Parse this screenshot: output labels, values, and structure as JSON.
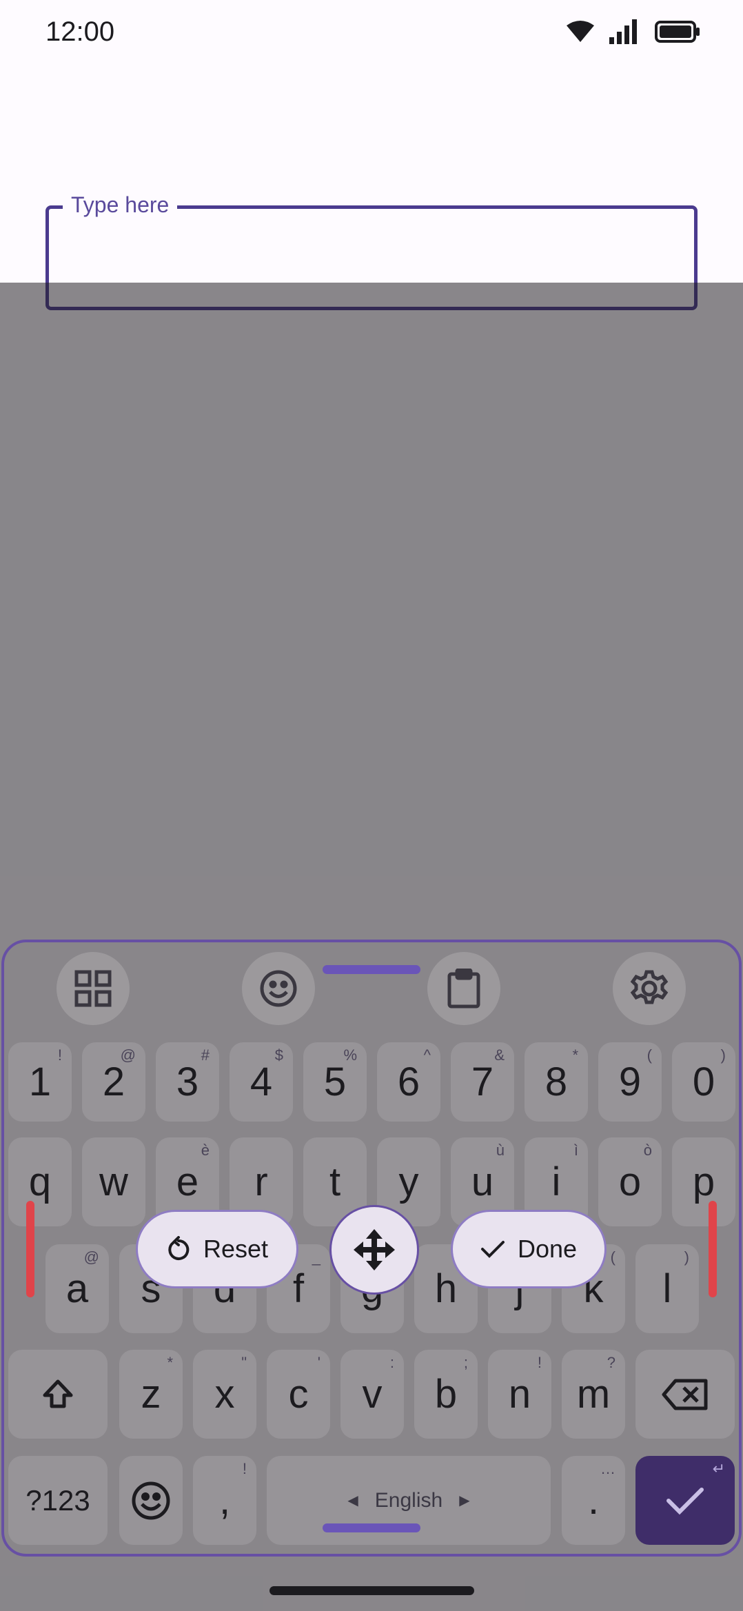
{
  "status_bar": {
    "time": "12:00"
  },
  "text_field": {
    "label": "Type here",
    "value": ""
  },
  "toolbar": {
    "icons": [
      "apps-grid-icon",
      "emoji-icon",
      "clipboard-icon",
      "gear-icon"
    ]
  },
  "keyboard": {
    "number_row": [
      {
        "key": "1",
        "hint": "!"
      },
      {
        "key": "2",
        "hint": "@"
      },
      {
        "key": "3",
        "hint": "#"
      },
      {
        "key": "4",
        "hint": "$"
      },
      {
        "key": "5",
        "hint": "%"
      },
      {
        "key": "6",
        "hint": "^"
      },
      {
        "key": "7",
        "hint": "&"
      },
      {
        "key": "8",
        "hint": "*"
      },
      {
        "key": "9",
        "hint": "("
      },
      {
        "key": "0",
        "hint": ")"
      }
    ],
    "row1": [
      {
        "key": "q",
        "hint": ""
      },
      {
        "key": "w",
        "hint": ""
      },
      {
        "key": "e",
        "hint": "è"
      },
      {
        "key": "r",
        "hint": ""
      },
      {
        "key": "t",
        "hint": ""
      },
      {
        "key": "y",
        "hint": ""
      },
      {
        "key": "u",
        "hint": "ù"
      },
      {
        "key": "i",
        "hint": "ì"
      },
      {
        "key": "o",
        "hint": "ò"
      },
      {
        "key": "p",
        "hint": ""
      }
    ],
    "row2": [
      {
        "key": "a",
        "hint": "@"
      },
      {
        "key": "s",
        "hint": ""
      },
      {
        "key": "d",
        "hint": ""
      },
      {
        "key": "f",
        "hint": "_"
      },
      {
        "key": "g",
        "hint": ""
      },
      {
        "key": "h",
        "hint": ""
      },
      {
        "key": "j",
        "hint": ""
      },
      {
        "key": "k",
        "hint": "("
      },
      {
        "key": "l",
        "hint": ")"
      }
    ],
    "row3": [
      {
        "key": "z",
        "hint": "*"
      },
      {
        "key": "x",
        "hint": "\""
      },
      {
        "key": "c",
        "hint": "'"
      },
      {
        "key": "v",
        "hint": ":"
      },
      {
        "key": "b",
        "hint": ";"
      },
      {
        "key": "n",
        "hint": "!"
      },
      {
        "key": "m",
        "hint": "?"
      }
    ],
    "symbols_label": "?123",
    "comma": ",",
    "comma_hint": "!",
    "space_label": "English",
    "period": ".",
    "period_hint": "…",
    "enter_hint": "↵"
  },
  "resize_overlay": {
    "reset_label": "Reset",
    "done_label": "Done"
  },
  "colors": {
    "accent": "#6750a4",
    "enter_key": "#3f2d69",
    "resize_bar": "#e0444a"
  }
}
